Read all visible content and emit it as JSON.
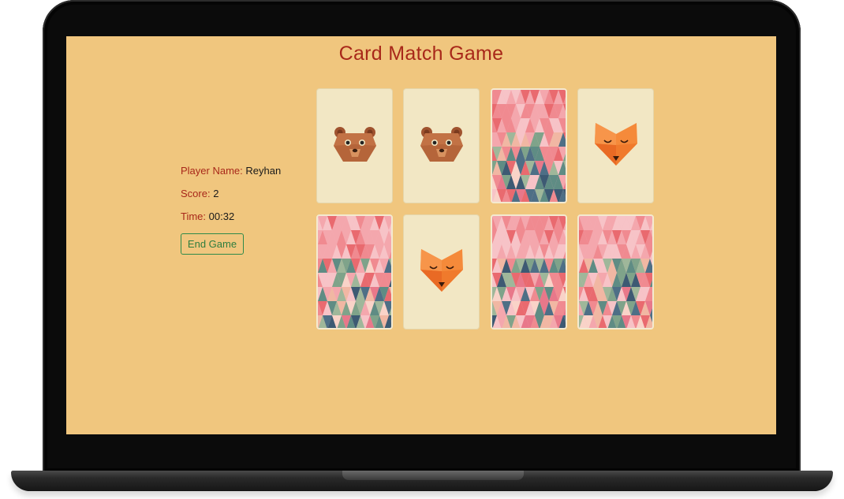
{
  "game": {
    "title": "Card Match Game",
    "player_label": "Player Name:",
    "player_value": "Reyhan",
    "score_label": "Score:",
    "score_value": "2",
    "time_label": "Time:",
    "time_value": "00:32",
    "end_button_label": "End Game"
  },
  "cards": [
    {
      "state": "face-up",
      "animal": "bear"
    },
    {
      "state": "face-up",
      "animal": "bear"
    },
    {
      "state": "face-down",
      "animal": ""
    },
    {
      "state": "face-up",
      "animal": "fox"
    },
    {
      "state": "face-down",
      "animal": ""
    },
    {
      "state": "face-up",
      "animal": "fox"
    },
    {
      "state": "face-down",
      "animal": ""
    },
    {
      "state": "face-down",
      "animal": ""
    }
  ],
  "colors": {
    "background": "#f0c67e",
    "title": "#a8281a",
    "label": "#a8281a",
    "button": "#2e7d3e",
    "card_face": "#f2e7c4"
  }
}
